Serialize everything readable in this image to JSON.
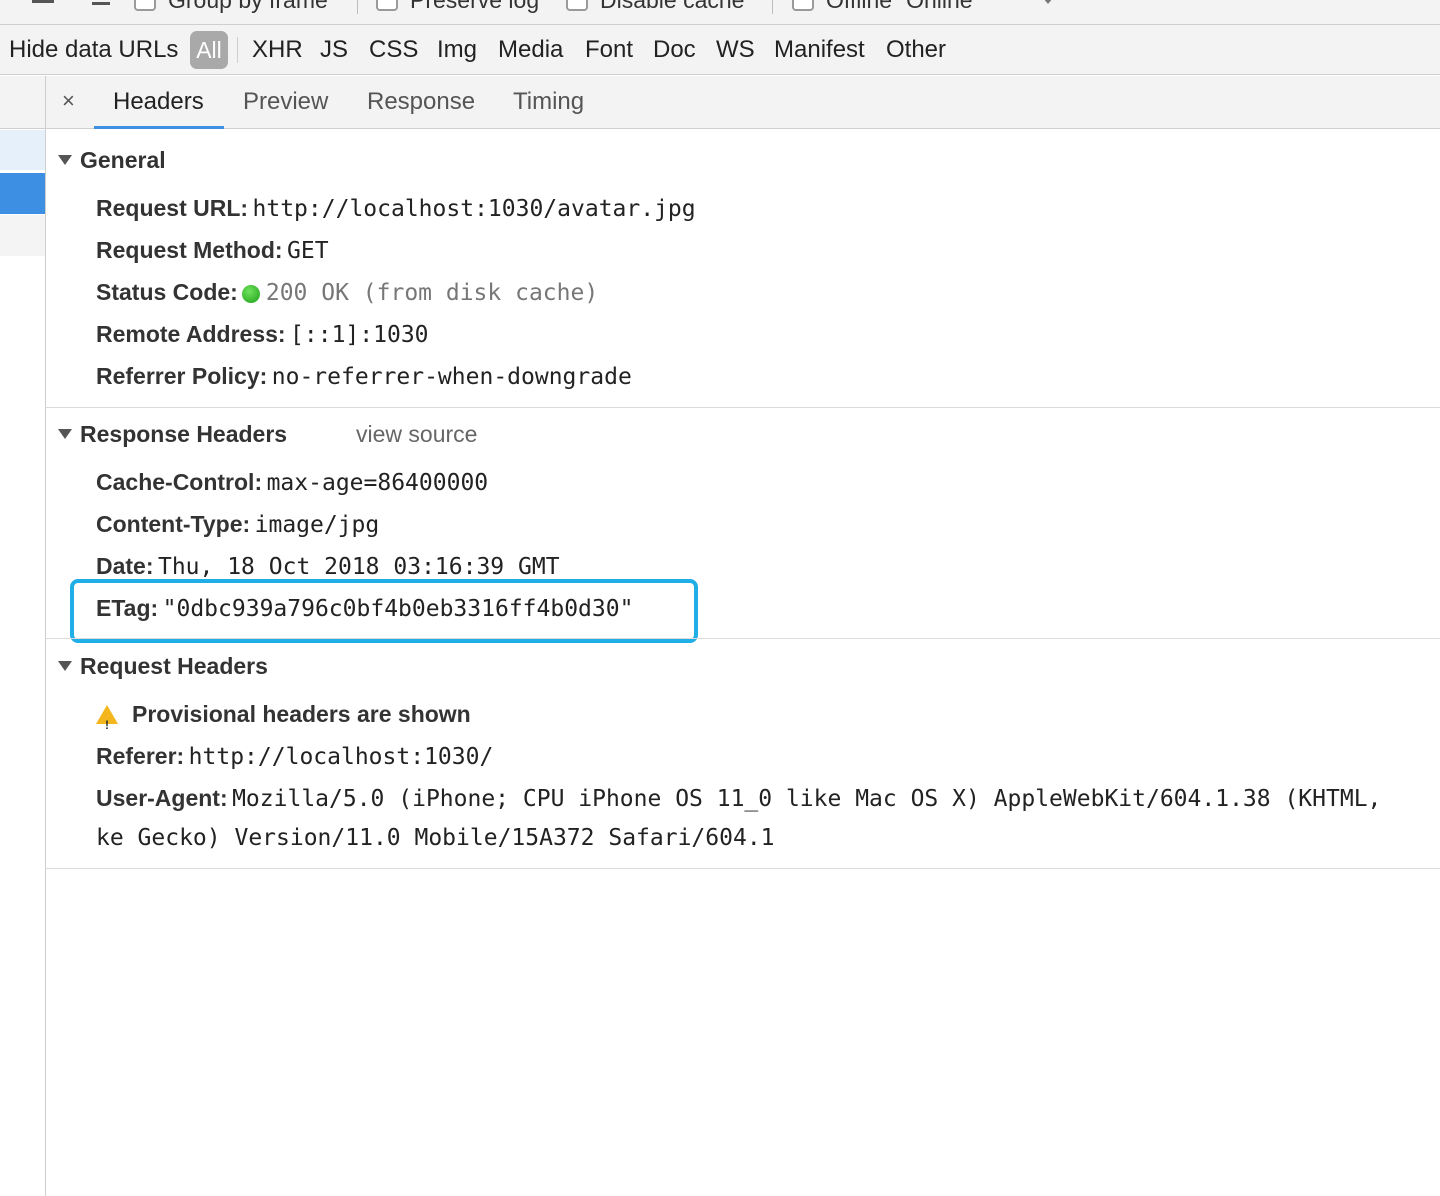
{
  "toolbar": {
    "group_by_frame_label": "Group by frame",
    "preserve_log_label": "Preserve log",
    "disable_cache_label": "Disable cache",
    "online_label": "Offline",
    "throttle_value": "Online"
  },
  "filter_bar": {
    "hide_data_urls_label": "Hide data URLs",
    "types": [
      "All",
      "XHR",
      "JS",
      "CSS",
      "Img",
      "Media",
      "Font",
      "Doc",
      "WS",
      "Manifest",
      "Other"
    ]
  },
  "tabs": {
    "close_label": "×",
    "items": [
      "Headers",
      "Preview",
      "Response",
      "Timing"
    ],
    "active": "Headers"
  },
  "general": {
    "title": "General",
    "rows": [
      {
        "name": "Request URL:",
        "value": "http://localhost:1030/avatar.jpg"
      },
      {
        "name": "Request Method:",
        "value": "GET"
      },
      {
        "name": "Status Code:",
        "value": "200 OK (from disk cache)",
        "status_color": "#2fb52a"
      },
      {
        "name": "Remote Address:",
        "value": "[::1]:1030"
      },
      {
        "name": "Referrer Policy:",
        "value": "no-referrer-when-downgrade"
      }
    ]
  },
  "response_headers": {
    "title": "Response Headers",
    "view_source_label": "view source",
    "rows": [
      {
        "name": "Cache-Control:",
        "value": "max-age=86400000"
      },
      {
        "name": "Content-Type:",
        "value": "image/jpg"
      },
      {
        "name": "Date:",
        "value": "Thu, 18 Oct 2018 03:16:39 GMT"
      },
      {
        "name": "ETag:",
        "value": "\"0dbc939a796c0bf4b0eb3316ff4b0d30\""
      }
    ],
    "highlight_color": "#1faee6"
  },
  "request_headers": {
    "title": "Request Headers",
    "warning_text": "Provisional headers are shown",
    "rows": [
      {
        "name": "Referer:",
        "value": "http://localhost:1030/"
      },
      {
        "name": "User-Agent:",
        "value": "Mozilla/5.0 (iPhone; CPU iPhone OS 11_0 like Mac OS X) AppleWebKit/604.1.38 (KHTML,",
        "value_cont": "ke Gecko) Version/11.0 Mobile/15A372 Safari/604.1"
      }
    ]
  },
  "colors": {
    "accent": "#3d8fe3",
    "highlight": "#1faee6",
    "warning": "#f3b71d"
  }
}
